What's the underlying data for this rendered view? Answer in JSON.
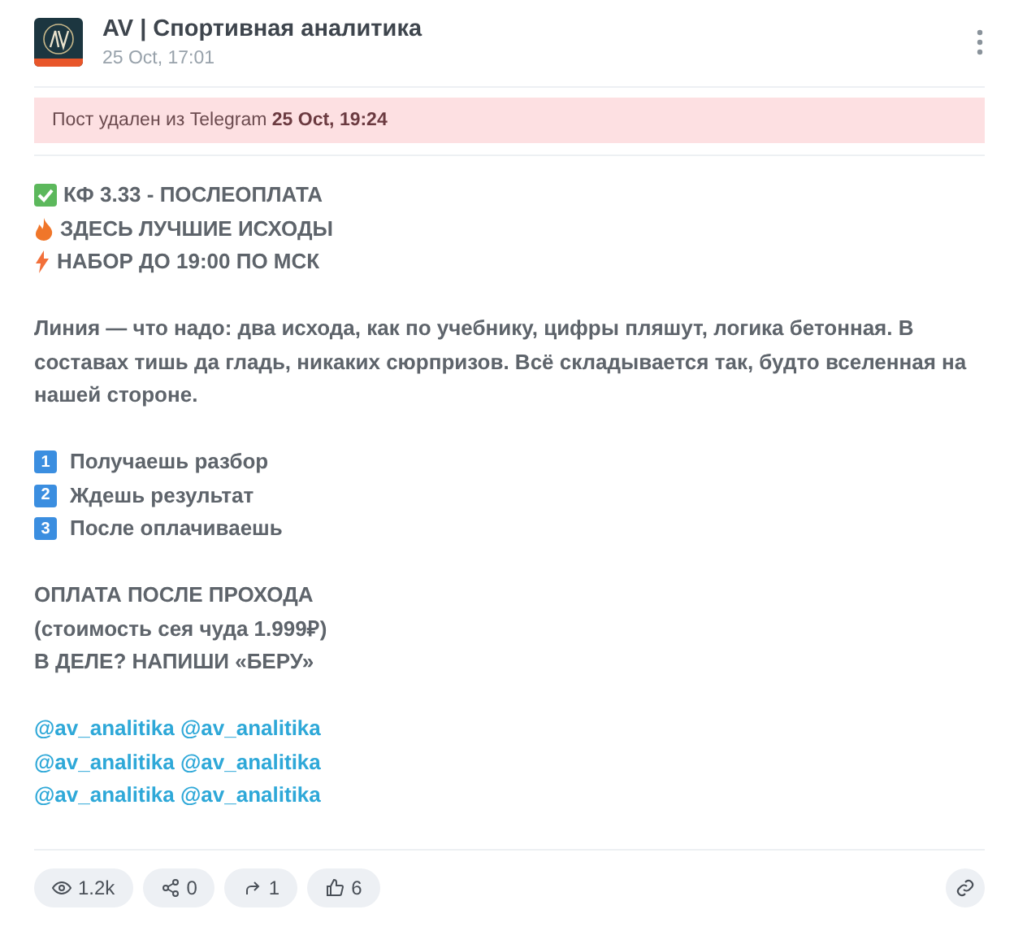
{
  "channel": {
    "name": "AV | Спортивная аналитика",
    "time": "25 Oct, 17:01"
  },
  "notice": "Пост удален из Telegram **25 Oct, 19:24**",
  "paragraphs": [
    [
      {
        "kind": "check",
        "text": "КФ 3.33 - ПОСЛЕОПЛАТА"
      },
      {
        "kind": "fire",
        "text": "ЗДЕСЬ ЛУЧШИЕ ИСХОДЫ"
      },
      {
        "kind": "bolt",
        "text": "НАБОР ДО 19:00 ПО МСК"
      }
    ],
    [
      {
        "kind": "plain",
        "text": "Линия — что надо: два исхода, как по учебнику, цифры пляшут, логика бетонная. В составах тишь да гладь, никаких сюрпризов. Всё складывается так, будто вселенная на нашей стороне."
      }
    ],
    [
      {
        "kind": "key",
        "key": "1",
        "text": "Получаешь разбор"
      },
      {
        "kind": "key",
        "key": "2",
        "text": "Ждешь результат"
      },
      {
        "kind": "key",
        "key": "3",
        "text": "После оплачиваешь"
      }
    ],
    [
      {
        "kind": "plain",
        "text": "ОПЛАТА ПОСЛЕ ПРОХОДА"
      },
      {
        "kind": "plain",
        "text": "(стоимость сея чуда 1.999₽)"
      },
      {
        "kind": "plain",
        "text": "В ДЕЛЕ? НАПИШИ «БЕРУ»"
      }
    ],
    [
      {
        "kind": "link",
        "text": "@av_analitika @av_analitika"
      },
      {
        "kind": "link",
        "text": "@av_analitika @av_analitika"
      },
      {
        "kind": "link",
        "text": "@av_analitika @av_analitika"
      }
    ]
  ],
  "stats": [
    {
      "kind": "views",
      "value": "1.2k"
    },
    {
      "kind": "shares",
      "value": "0"
    },
    {
      "kind": "forwards",
      "value": "1"
    },
    {
      "kind": "likes",
      "value": "6"
    }
  ]
}
